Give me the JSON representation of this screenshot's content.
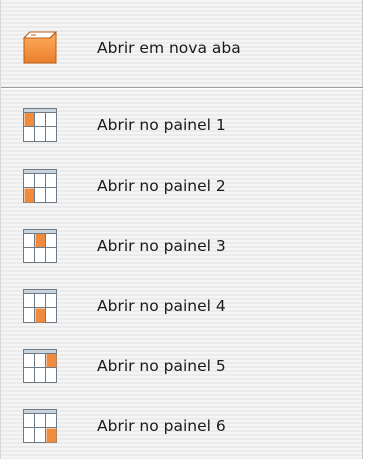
{
  "menu": {
    "items": [
      {
        "label": "Abrir em nova aba",
        "icon": "new-tab-icon"
      },
      {
        "label": "Abrir no painel 1",
        "icon": "panel-1-icon",
        "panel": 1
      },
      {
        "label": "Abrir no painel 2",
        "icon": "panel-2-icon",
        "panel": 2
      },
      {
        "label": "Abrir no painel 3",
        "icon": "panel-3-icon",
        "panel": 3
      },
      {
        "label": "Abrir no painel 4",
        "icon": "panel-4-icon",
        "panel": 4
      },
      {
        "label": "Abrir no painel 5",
        "icon": "panel-5-icon",
        "panel": 5
      },
      {
        "label": "Abrir no painel 6",
        "icon": "panel-6-icon",
        "panel": 6
      }
    ]
  },
  "colors": {
    "accent": "#f08a3c",
    "grid_line": "#6e7a86",
    "grid_fill": "#ffffff",
    "grid_header": "#c9d3dc"
  }
}
